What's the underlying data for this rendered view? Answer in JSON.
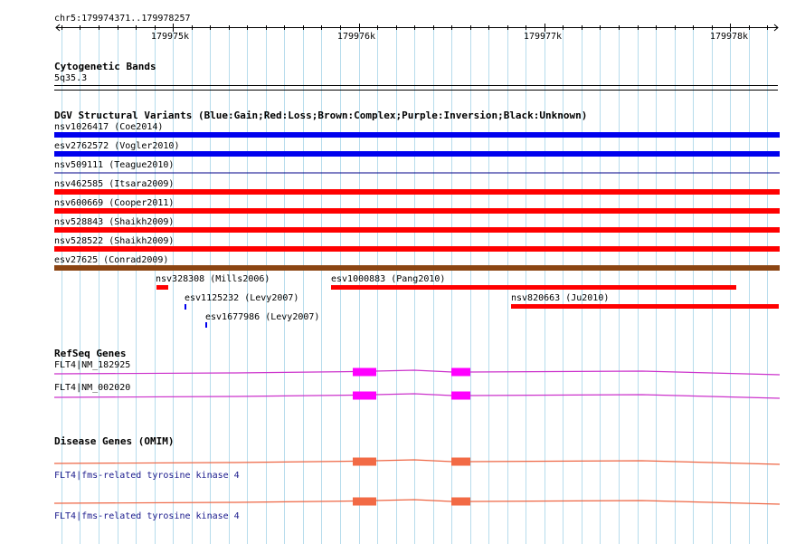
{
  "ruler": {
    "location": "chr5:179974371..179978257",
    "start": 179974371,
    "end": 179978257,
    "ticks": [
      {
        "pos": 179975000,
        "label": "179975k"
      },
      {
        "pos": 179976000,
        "label": "179976k"
      },
      {
        "pos": 179977000,
        "label": "179977k"
      },
      {
        "pos": 179978000,
        "label": "179978k"
      }
    ]
  },
  "cytoband": {
    "title": "Cytogenetic Bands",
    "band": "5q35.3"
  },
  "dgv": {
    "title": "DGV Structural Variants (Blue:Gain;Red:Loss;Brown:Complex;Purple:Inversion;Black:Unknown)",
    "colors": {
      "gain": "#0000ee",
      "loss": "#ff0000",
      "complex": "#8b4513",
      "unknown": "#000088"
    },
    "variants": [
      {
        "label": "nsv1026417 (Coe2014)",
        "type": "gain",
        "full": true
      },
      {
        "label": "esv2762572 (Vogler2010)",
        "type": "gain",
        "full": true
      },
      {
        "label": "nsv509111 (Teague2010)",
        "type": "unknown",
        "full": true,
        "thin": true
      },
      {
        "label": "nsv462585 (Itsara2009)",
        "type": "loss",
        "full": true
      },
      {
        "label": "nsv600669 (Cooper2011)",
        "type": "loss",
        "full": true
      },
      {
        "label": "nsv528843 (Shaikh2009)",
        "type": "loss",
        "full": true
      },
      {
        "label": "nsv528522 (Shaikh2009)",
        "type": "loss",
        "full": true
      },
      {
        "label": "esv27625 (Conrad2009)",
        "type": "complex",
        "full": true
      }
    ],
    "small_variants": [
      {
        "label": "nsv328308 (Mills2006)",
        "type": "loss"
      },
      {
        "label": "esv1000883 (Pang2010)",
        "type": "loss"
      },
      {
        "label": "esv1125232 (Levy2007)",
        "type": "gain"
      },
      {
        "label": "nsv820663 (Ju2010)",
        "type": "loss"
      },
      {
        "label": "esv1677986 (Levy2007)",
        "type": "gain"
      }
    ]
  },
  "refseq": {
    "title": "RefSeq Genes",
    "color": "#cc33cc",
    "exon_color": "#ff00ff",
    "genes": [
      {
        "label": "FLT4|NM_182925"
      },
      {
        "label": "FLT4|NM_002020"
      }
    ]
  },
  "omim": {
    "title": "Disease Genes (OMIM)",
    "color": "#ee6644",
    "exon_color": "#f26a45",
    "genes": [
      {
        "label": "FLT4|fms-related tyrosine kinase 4"
      },
      {
        "label": "FLT4|fms-related tyrosine kinase 4"
      }
    ]
  }
}
